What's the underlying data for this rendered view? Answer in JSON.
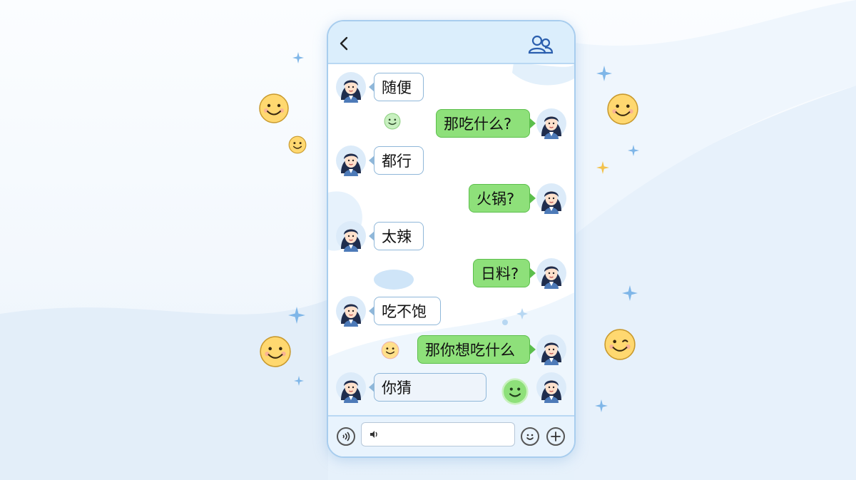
{
  "header": {
    "back_icon": "chevron-left-icon",
    "contacts_icon": "group-icon"
  },
  "messages": [
    {
      "side": "left",
      "text": "随便"
    },
    {
      "side": "right",
      "text": "那吃什么?"
    },
    {
      "side": "left",
      "text": "都行"
    },
    {
      "side": "right",
      "text": "火锅?"
    },
    {
      "side": "left",
      "text": "太辣"
    },
    {
      "side": "right",
      "text": "日料?"
    },
    {
      "side": "left",
      "text": "吃不饱"
    },
    {
      "side": "right",
      "text": "那你想吃什么"
    },
    {
      "side": "left",
      "text": "你猜"
    }
  ],
  "composer": {
    "voice_icon": "voice-icon",
    "input_value": "",
    "emoji_icon": "emoji-icon",
    "add_icon": "plus-icon"
  },
  "colors": {
    "header_bg": "#dbeefc",
    "sent_bubble": "#8ee07a",
    "received_border": "#8fb7d9",
    "accent": "#a8cdee"
  }
}
